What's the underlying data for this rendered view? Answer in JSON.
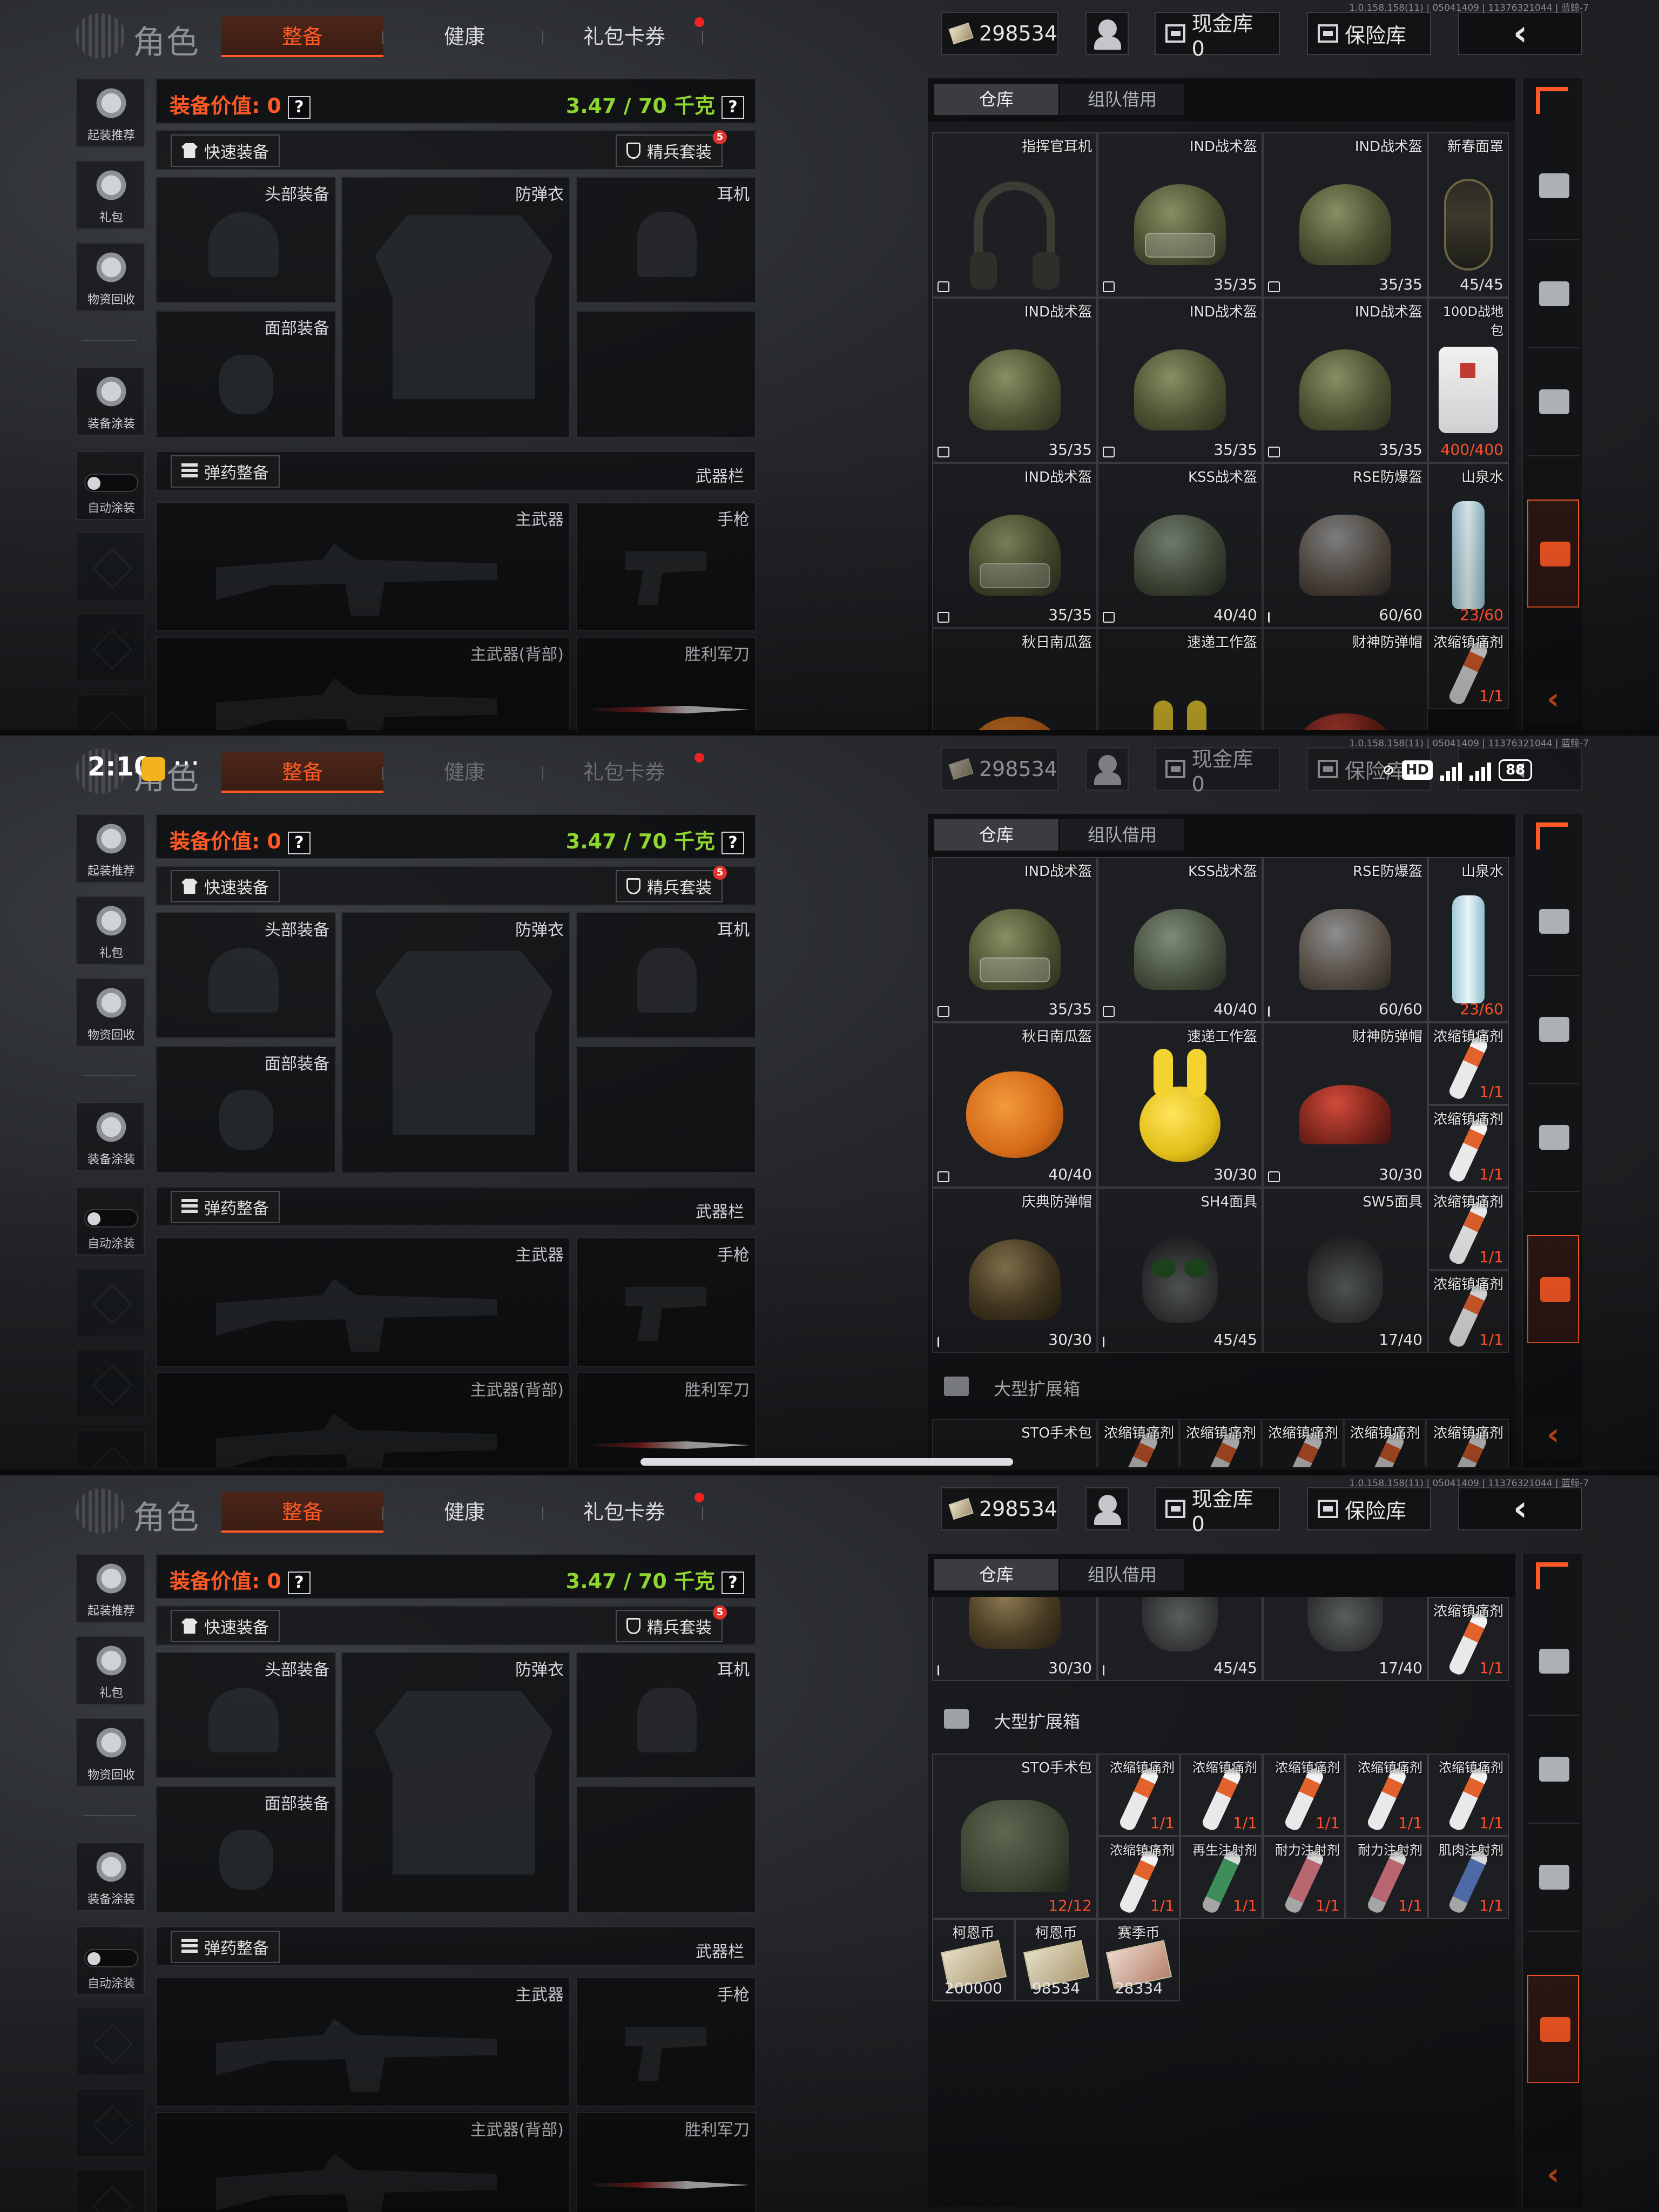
{
  "app": {
    "title": "角色",
    "build": "1.0.158.158(11) | 05041409 | 11376321044 | 蓝鲸-7"
  },
  "tabs": {
    "equip": "整备",
    "health": "健康",
    "gift": "礼包卡券"
  },
  "topbar": {
    "money": "298534",
    "cash_vault": "现金库 0",
    "safe_vault": "保险库"
  },
  "status": {
    "time": "2:10",
    "dots": "···",
    "battery": "88"
  },
  "sidebar": {
    "recommend": "起装推荐",
    "gift": "礼包",
    "recycle": "物资回收",
    "paint": "装备涂装",
    "auto_paint": "自动涂装"
  },
  "equip": {
    "value_label": "装备价值: 0",
    "weight": "3.47 / 70 千克",
    "q": "?",
    "quick_equip": "快速装备",
    "elite_suit": "精兵套装",
    "elite_badge": "5",
    "slots": {
      "head": "头部装备",
      "armor": "防弹衣",
      "headset": "耳机",
      "face": "面部装备",
      "ammo": "弹药整备",
      "weapon_bar": "武器栏",
      "main": "主武器",
      "pistol": "手枪",
      "main_back": "主武器(背部)",
      "knife": "胜利军刀"
    }
  },
  "warehouse": {
    "tab_store": "仓库",
    "tab_team": "组队借用",
    "section_large": "大型扩展箱",
    "items": {
      "cmd_headset": "指挥官耳机",
      "ind": "IND战术盔",
      "newyear_mask": "新春面罩",
      "pouch100": "100D战地包",
      "kss": "KSS战术盔",
      "rse": "RSE防爆盔",
      "water": "山泉水",
      "pumpkin": "秋日南瓜盔",
      "courier": "速递工作盔",
      "fortune": "财神防弹帽",
      "painkiller": "浓缩镇痛剂",
      "celebration": "庆典防弹帽",
      "sh4": "SH4面具",
      "sw5": "SW5面具",
      "sto": "STO手术包",
      "regen": "再生注射剂",
      "endure": "耐力注射剂",
      "muscle": "肌肉注射剂",
      "kehn": "柯恩币",
      "season": "赛季币"
    },
    "counts": {
      "c35": "35/35",
      "c45": "45/45",
      "c400": "400/400",
      "c40": "40/40",
      "c60": "60/60",
      "c23": "23/60",
      "c11": "1/1",
      "c30": "30/30",
      "c4040": "40/40",
      "c17": "17/40",
      "c1212": "12/12",
      "v200000": "200000",
      "v98534": "98534",
      "v28334": "28334"
    }
  },
  "colors": {
    "accent": "#ff5a25",
    "weight_green": "#8fd531",
    "badge_red": "#e2312a"
  },
  "icons": [
    "cash-icon",
    "avatar-icon",
    "vault-icon",
    "safe-icon",
    "back-arrow-icon",
    "shirt-icon",
    "shield-icon",
    "bullets-icon",
    "box-icon",
    "collapse-arrow-icon"
  ]
}
